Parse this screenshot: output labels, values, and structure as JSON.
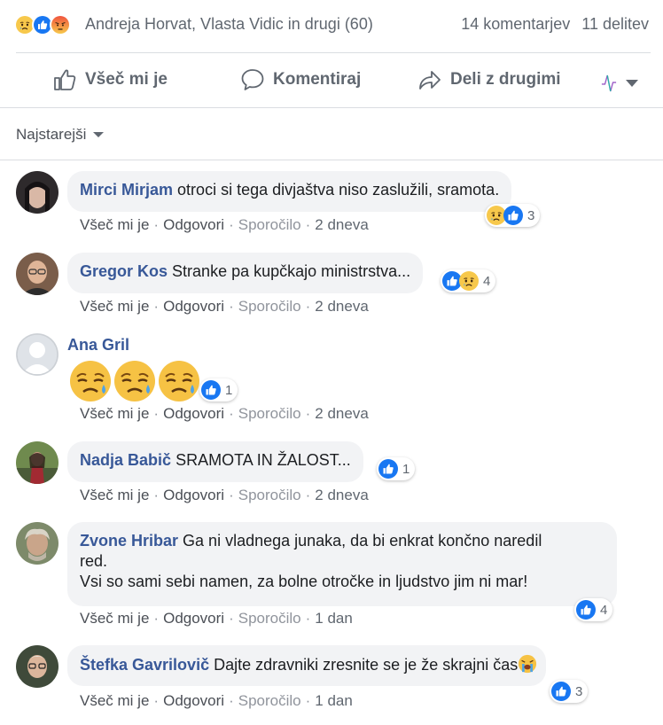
{
  "summary": {
    "reactions": [
      "sad-icon",
      "like-icon",
      "angry-icon"
    ],
    "names": "Andreja Horvat, Vlasta Vidic in drugi (60)",
    "comments": "14 komentarjev",
    "shares": "11 delitev"
  },
  "actions": {
    "like": "Všeč mi je",
    "comment": "Komentiraj",
    "share": "Deli z drugimi"
  },
  "sort": {
    "label": "Najstarejši"
  },
  "meta_labels": {
    "like": "Všeč mi je",
    "reply": "Odgovori",
    "message": "Sporočilo"
  },
  "colors": {
    "accent": "#385898",
    "like_blue": "#1877f2",
    "bubble_bg": "#f2f3f5"
  },
  "comments": [
    {
      "author": "Mirci Mirjam",
      "text": "otroci si tega divjaštva niso zaslužili, sramota.",
      "time": "2 dneva",
      "reactions": [
        "sad-icon",
        "like-icon"
      ],
      "count": "3"
    },
    {
      "author": "Gregor Kos",
      "text": "Stranke pa kupčkajo ministrstva...",
      "time": "2 dneva",
      "reactions": [
        "like-icon",
        "sad-icon"
      ],
      "count": "4"
    },
    {
      "author": "Ana Gril",
      "text": "",
      "time": "2 dneva",
      "reactions": [
        "like-icon"
      ],
      "count": "1",
      "emoji": [
        "crying-face-icon",
        "crying-face-icon",
        "crying-face-icon"
      ]
    },
    {
      "author": "Nadja Babič",
      "text": "SRAMOTA IN ŽALOST...",
      "time": "2 dneva",
      "reactions": [
        "like-icon"
      ],
      "count": "1"
    },
    {
      "author": "Zvone Hribar",
      "text_line1": "Ga ni vladnega junaka, da bi enkrat končno naredil",
      "text_line2": "red.",
      "text_line3": "Vsi so sami sebi namen, za bolne otročke in ljudstvo jim ni mar!",
      "time": "1 dan",
      "reactions": [
        "like-icon"
      ],
      "count": "4"
    },
    {
      "author": "Štefka Gavrilovič",
      "text": "Dajte zdravniki zresnite se je že skrajni čas",
      "time": "1 dan",
      "reactions": [
        "like-icon"
      ],
      "count": "3",
      "trailing_emoji": "loudly-crying-face-icon"
    }
  ]
}
